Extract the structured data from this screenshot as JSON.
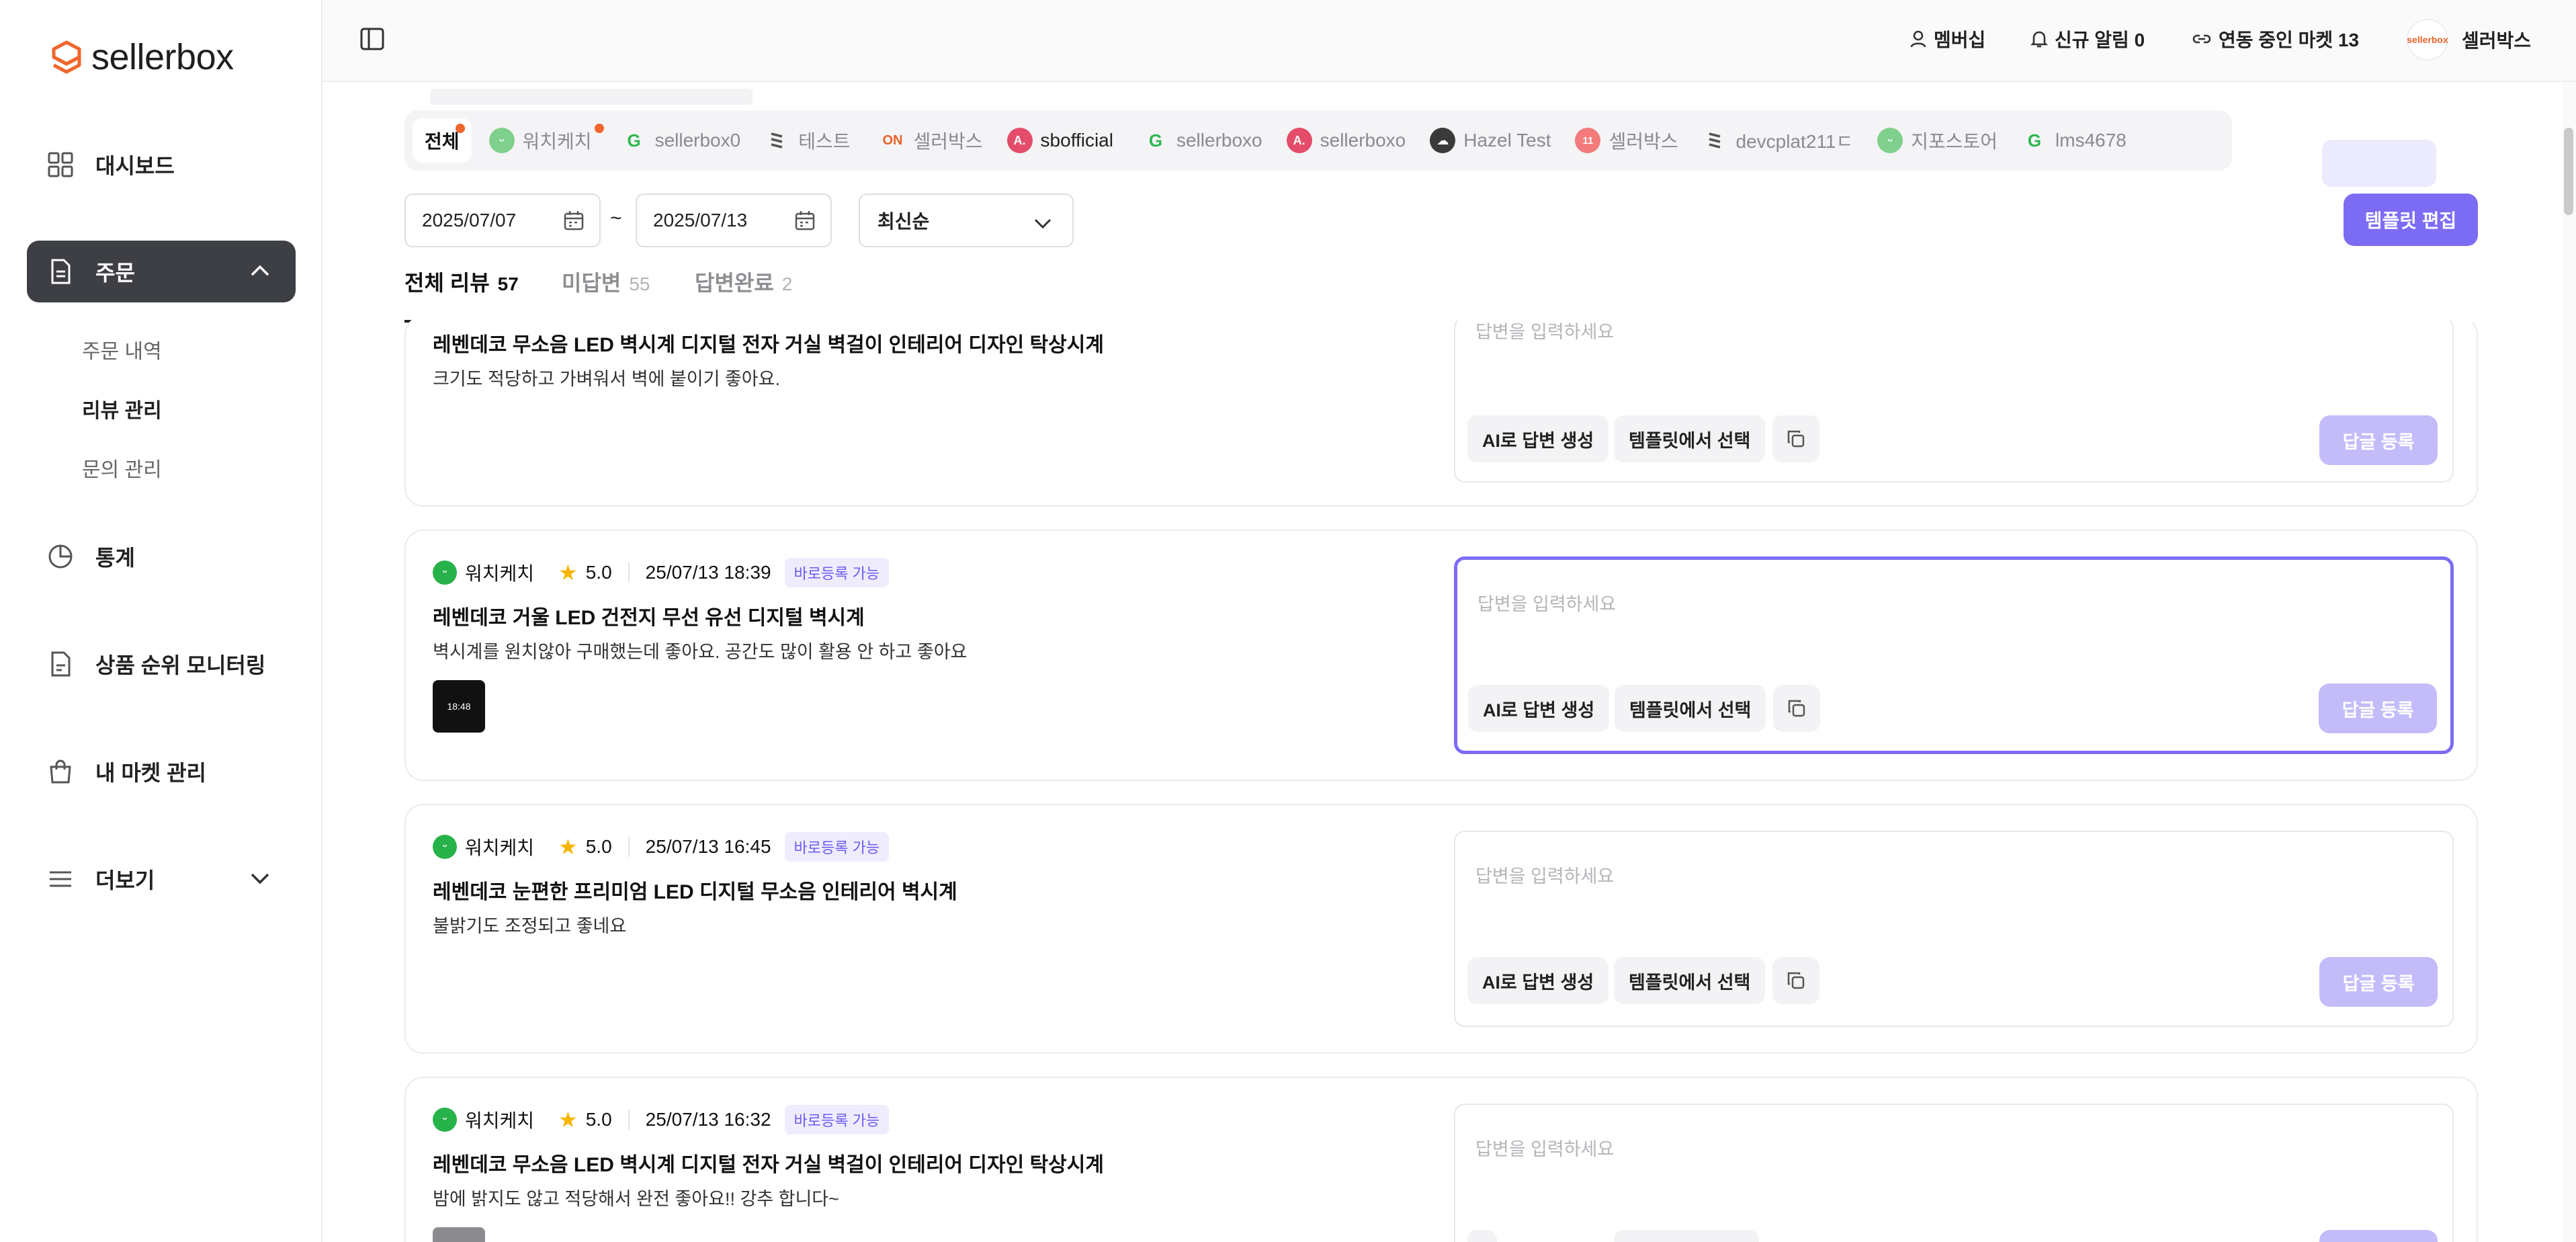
{
  "brand": {
    "name": "sellerbox",
    "accent": "#7c6cf4",
    "logo_color": "#f0662c"
  },
  "sidebar": {
    "items": [
      {
        "label": "대시보드",
        "icon": "grid-icon"
      },
      {
        "label": "주문",
        "icon": "document-icon",
        "active": true,
        "expanded": true
      },
      {
        "label": "통계",
        "icon": "pie-chart-icon"
      },
      {
        "label": "상품 순위 모니터링",
        "icon": "file-icon"
      },
      {
        "label": "내 마켓 관리",
        "icon": "shopping-bag-icon"
      },
      {
        "label": "더보기",
        "icon": "menu-icon"
      }
    ],
    "sub_items": [
      {
        "label": "주문 내역"
      },
      {
        "label": "리뷰 관리",
        "active": true
      },
      {
        "label": "문의 관리"
      }
    ]
  },
  "header": {
    "membership": "멤버십",
    "notifications": "신규 알림 0",
    "linked_markets": "연동 중인 마켓 13",
    "user_name": "셀러박스",
    "avatar_text": "sellerbox"
  },
  "markets": [
    {
      "label": "전체",
      "active": true,
      "dot": true,
      "icon": ""
    },
    {
      "label": "워치케치",
      "dot": true,
      "icon": "watchkechi-icon",
      "color": "#27b24a"
    },
    {
      "label": "sellerbox0",
      "icon": "g-icon",
      "color": "#2db84f"
    },
    {
      "label": "테스트",
      "icon": "stripes-icon",
      "color": "#555555"
    },
    {
      "label": "셀러박스",
      "icon": "on-icon",
      "color": "#e8632b"
    },
    {
      "label": "sbofficial",
      "icon": "a-icon",
      "color": "#e44d6a"
    },
    {
      "label": "sellerboxo",
      "icon": "g-icon",
      "color": "#2db84f"
    },
    {
      "label": "sellerboxo",
      "icon": "a-icon",
      "color": "#e44d6a"
    },
    {
      "label": "Hazel Test",
      "icon": "cloud-icon",
      "color": "#3a3a3a"
    },
    {
      "label": "셀러박스",
      "icon": "11st-icon",
      "color": "#f05a5a"
    },
    {
      "label": "devcplat211ㄷ",
      "icon": "stripes-icon",
      "color": "#555555"
    },
    {
      "label": "지포스토어",
      "icon": "watchkechi-icon",
      "color": "#27b24a"
    },
    {
      "label": "lms4678",
      "icon": "g-icon",
      "color": "#2db84f"
    }
  ],
  "filters": {
    "start_date": "2025/07/07",
    "range_separator": "~",
    "end_date": "2025/07/13",
    "sort": "최신순",
    "template_button": "템플릿 편집"
  },
  "tabs": [
    {
      "label": "전체 리뷰",
      "count": "57",
      "active": true
    },
    {
      "label": "미답변",
      "count": "55"
    },
    {
      "label": "답변완료",
      "count": "2"
    }
  ],
  "reply": {
    "placeholder": "답변을 입력하세요",
    "ai_button": "AI로 답변 생성",
    "template_button": "템플릿에서 선택",
    "submit_button": "답글 등록"
  },
  "reviews": [
    {
      "title": "레벤데코 무소음 LED 벽시계 디지털 전자 거실 벽걸이 인테리어 디자인 탁상시계",
      "body": "크기도 적당하고 가벼워서 벽에 붙이기 좋아요."
    },
    {
      "market": "워치케치",
      "rating": "5.0",
      "date": "25/07/13 18:39",
      "badge": "바로등록 가능",
      "title": "레벤데코 거울 LED 건전지 무선 유선 디지털 벽시계",
      "body": "벽시계를 원치않아 구매했는데 좋아요. 공간도 많이 활용 안 하고 좋아요",
      "thumb_text": "18:48"
    },
    {
      "market": "워치케치",
      "rating": "5.0",
      "date": "25/07/13 16:45",
      "badge": "바로등록 가능",
      "title": "레벤데코 눈편한 프리미엄 LED 디지털 무소음 인테리어 벽시계",
      "body": "불밝기도 조정되고 좋네요"
    },
    {
      "market": "워치케치",
      "rating": "5.0",
      "date": "25/07/13 16:32",
      "badge": "바로등록 가능",
      "title": "레벤데코 무소음 LED 벽시계 디지털 전자 거실 벽걸이 인테리어 디자인 탁상시계",
      "body": "밤에 밝지도 않고 적당해서 완전 좋아요!! 강추 합니다~"
    }
  ]
}
